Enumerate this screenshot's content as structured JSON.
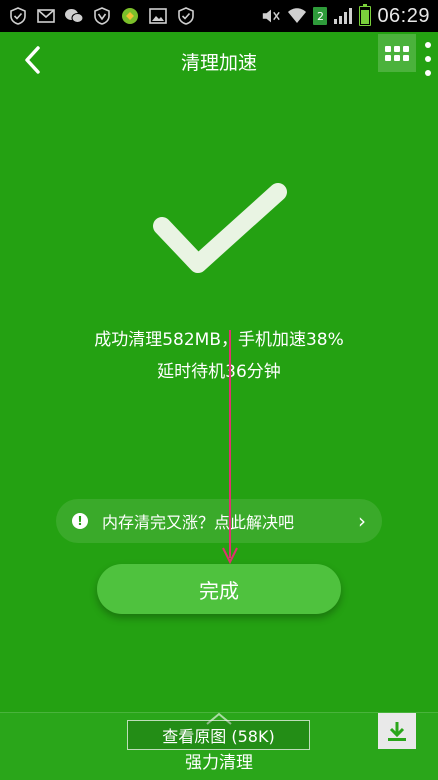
{
  "status_bar": {
    "time": "06:29",
    "sim_slot": "2",
    "icons": [
      "shield-check-icon",
      "mail-icon",
      "wechat-icon",
      "vpn-shield-icon",
      "app-icon",
      "gallery-icon",
      "shield-check-icon",
      "mute-icon",
      "wifi-icon",
      "signal-icon",
      "battery-icon"
    ]
  },
  "header": {
    "title": "清理加速"
  },
  "result": {
    "line1": "成功清理582MB，手机加速38%",
    "line2": "延时待机36分钟"
  },
  "tip": {
    "icon_glyph": "!",
    "text": "内存清完又涨？点此解决吧",
    "arrow": "›"
  },
  "done_button": {
    "label": "完成"
  },
  "bottom": {
    "view_original_label": "查看原图 (58K)",
    "force_clean_label": "强力清理"
  },
  "colors": {
    "background": "#24a112",
    "button": "#4fc23e",
    "annotation": "#e0336f"
  }
}
